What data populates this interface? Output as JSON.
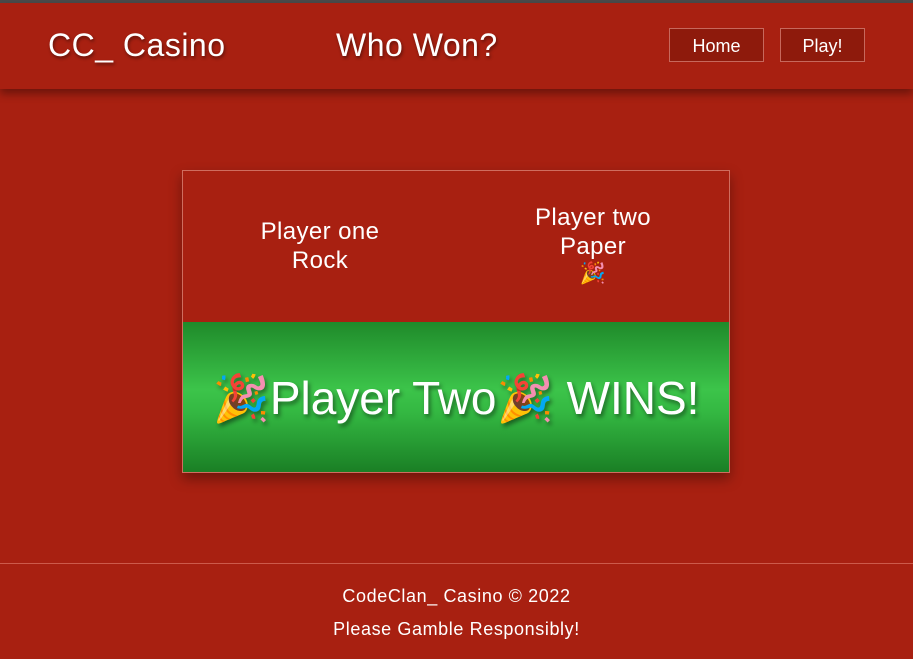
{
  "header": {
    "brand": "CC_ Casino",
    "title": "Who Won?",
    "nav": {
      "home_label": "Home",
      "play_label": "Play!"
    }
  },
  "result": {
    "player_one": {
      "name": "Player one",
      "choice": "Rock"
    },
    "player_two": {
      "name": "Player two",
      "choice": "Paper",
      "icon": "🎉"
    },
    "winner": {
      "icon": "🎉",
      "name": "Player Two",
      "suffix": " WINS!"
    }
  },
  "footer": {
    "copyright": "CodeClan_ Casino © 2022",
    "tagline": "Please Gamble Responsibly!"
  },
  "colors": {
    "background": "#a82011",
    "banner_green": "#3cc44a"
  },
  "icons": [
    "party-popper-icon"
  ]
}
